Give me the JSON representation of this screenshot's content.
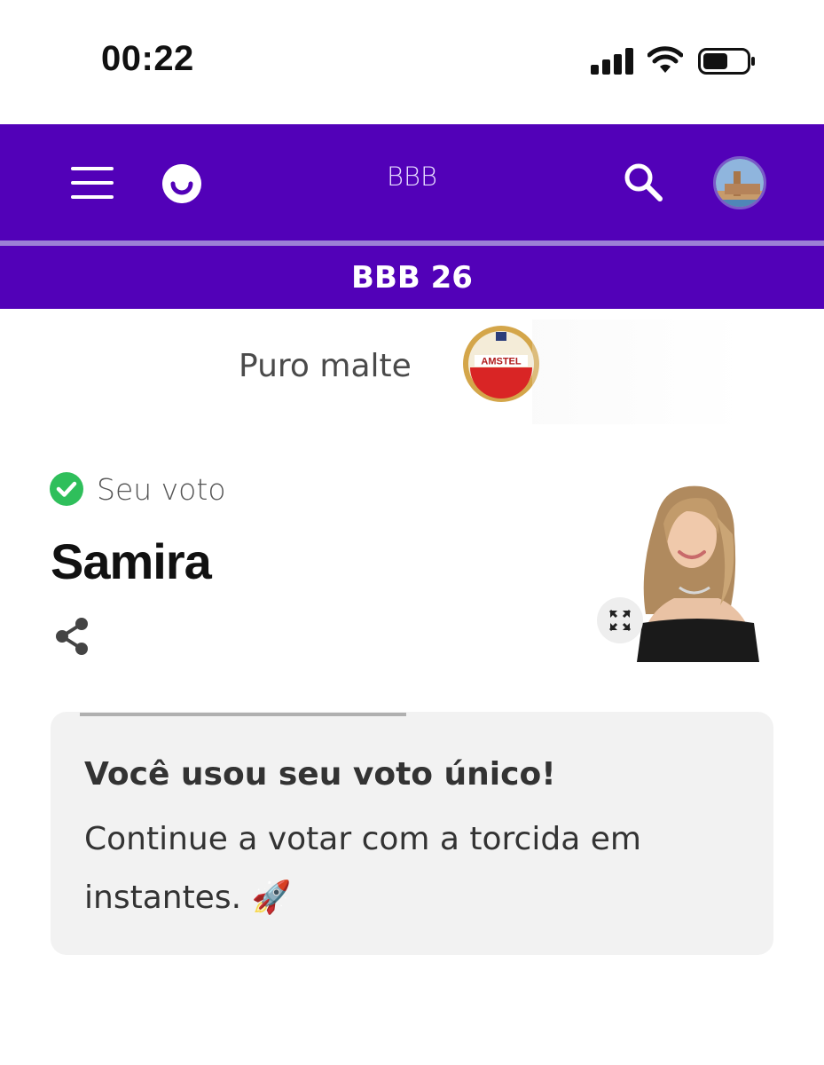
{
  "status_bar": {
    "time": "00:22",
    "icons": [
      "signal-icon",
      "wifi-icon",
      "battery-icon"
    ]
  },
  "header": {
    "menu_icon": "menu-icon",
    "logo_icon": "smile-logo-icon",
    "title": "BBB",
    "search_icon": "search-icon",
    "avatar_icon": "avatar"
  },
  "sub_header": {
    "title": "BBB 26"
  },
  "sponsor": {
    "text": "Puro malte",
    "logo_text": "AMSTEL"
  },
  "vote": {
    "status_label": "Seu voto",
    "candidate_name": "Samira",
    "share_icon": "share-icon",
    "expand_icon": "expand-icon"
  },
  "info_card": {
    "title": "Você usou seu voto único!",
    "body": "Continue a votar com a torcida em instantes. 🚀"
  },
  "colors": {
    "brand_purple": "#5201b8",
    "check_green": "#2fbf5b",
    "card_bg": "#f2f2f2"
  }
}
